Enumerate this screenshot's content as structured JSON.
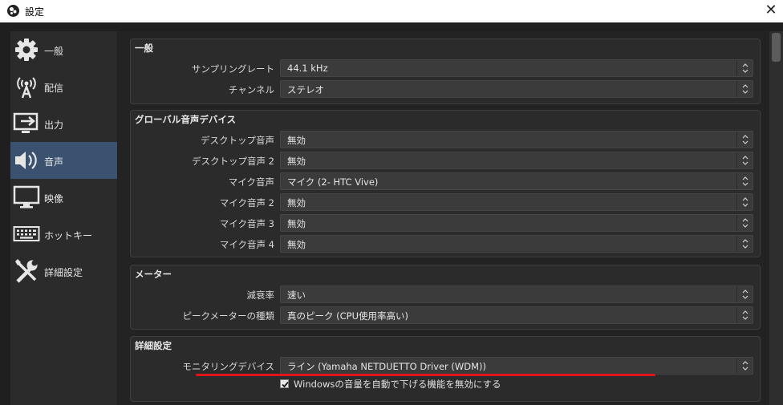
{
  "window": {
    "title": "設定",
    "close_label": "✕"
  },
  "sidebar": {
    "items": [
      {
        "label": "一般",
        "icon": "gear-icon"
      },
      {
        "label": "配信",
        "icon": "broadcast-antenna-icon"
      },
      {
        "label": "出力",
        "icon": "output-monitor-icon"
      },
      {
        "label": "音声",
        "icon": "speaker-icon",
        "active": true
      },
      {
        "label": "映像",
        "icon": "monitor-icon"
      },
      {
        "label": "ホットキー",
        "icon": "keyboard-icon"
      },
      {
        "label": "詳細設定",
        "icon": "tools-icon"
      }
    ]
  },
  "general": {
    "title": "一般",
    "sample_rate_label": "サンプリングレート",
    "sample_rate_value": "44.1 kHz",
    "channels_label": "チャンネル",
    "channels_value": "ステレオ"
  },
  "global_audio": {
    "title": "グローバル音声デバイス",
    "rows": [
      {
        "label": "デスクトップ音声",
        "value": "無効"
      },
      {
        "label": "デスクトップ音声 2",
        "value": "無効"
      },
      {
        "label": "マイク音声",
        "value": "マイク (2- HTC Vive)"
      },
      {
        "label": "マイク音声 2",
        "value": "無効"
      },
      {
        "label": "マイク音声 3",
        "value": "無効"
      },
      {
        "label": "マイク音声 4",
        "value": "無効"
      }
    ]
  },
  "meters": {
    "title": "メーター",
    "decay_label": "減衰率",
    "decay_value": "速い",
    "peak_label": "ピークメーターの種類",
    "peak_value": "真のピーク (CPU使用率高い)"
  },
  "advanced": {
    "title": "詳細設定",
    "monitoring_label": "モニタリングデバイス",
    "monitoring_value": "ライン (Yamaha NETDUETTO Driver (WDM))",
    "ducking_label": "Windowsの音量を自動で下げる機能を無効にする",
    "ducking_checked": true
  },
  "colors": {
    "accent": "#3a5170",
    "highlight_line": "#e0141b"
  }
}
